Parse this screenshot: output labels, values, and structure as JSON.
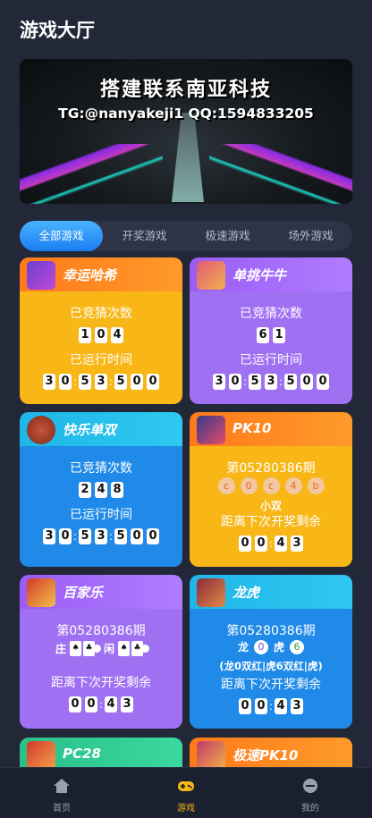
{
  "header": {
    "title": "游戏大厅"
  },
  "banner": {
    "line1": "搭建联系南亚科技",
    "line2": "TG:@nanyakeji1 QQ:1594833205"
  },
  "tabs": [
    "全部游戏",
    "开奖游戏",
    "极速游戏",
    "场外游戏"
  ],
  "games": {
    "xingyun": {
      "name": "幸运哈希",
      "label_count": "已竞猜次数",
      "count_digits": [
        "1",
        "0",
        "4"
      ],
      "label_time": "已运行时间",
      "time_digits": [
        "3",
        "0",
        "5",
        "3",
        "5",
        "0",
        "0"
      ]
    },
    "danti": {
      "name": "单挑牛牛",
      "label_count": "已竞猜次数",
      "count_digits": [
        "6",
        "1"
      ],
      "label_time": "已运行时间",
      "time_digits": [
        "3",
        "0",
        "5",
        "3",
        "5",
        "0",
        "0"
      ]
    },
    "kuaile": {
      "name": "快乐单双",
      "label_count": "已竞猜次数",
      "count_digits": [
        "2",
        "4",
        "8"
      ],
      "label_time": "已运行时间",
      "time_digits": [
        "3",
        "0",
        "5",
        "3",
        "5",
        "0",
        "0"
      ]
    },
    "pk10": {
      "name": "PK10",
      "period": "第05280386期",
      "balls": [
        "c",
        "0",
        "c",
        "4",
        "b"
      ],
      "result": "小双",
      "countdown_label": "距离下次开奖剩余",
      "countdown_digits": [
        "0",
        "0",
        "4",
        "3"
      ]
    },
    "baijia": {
      "name": "百家乐",
      "period": "第05280386期",
      "zhuang": "庄",
      "xian": "闲",
      "countdown_label": "距离下次开奖剩余",
      "countdown_digits": [
        "0",
        "0",
        "4",
        "3"
      ]
    },
    "longhu": {
      "name": "龙虎",
      "period": "第05280386期",
      "long": "龙",
      "hu": "虎",
      "long_ball": "0",
      "hu_ball": "6",
      "result": "(龙0双红|虎6双红|虎)",
      "countdown_label": "距离下次开奖剩余",
      "countdown_digits": [
        "0",
        "0",
        "4",
        "3"
      ]
    },
    "pc28": {
      "name": "PC28"
    },
    "jisu": {
      "name": "极速PK10"
    }
  },
  "nav": {
    "home": "首页",
    "games": "游戏",
    "mine": "我的"
  },
  "colors": {
    "accent": "#f6b516",
    "tab_active": "#1f86f5",
    "bg": "#232838"
  }
}
